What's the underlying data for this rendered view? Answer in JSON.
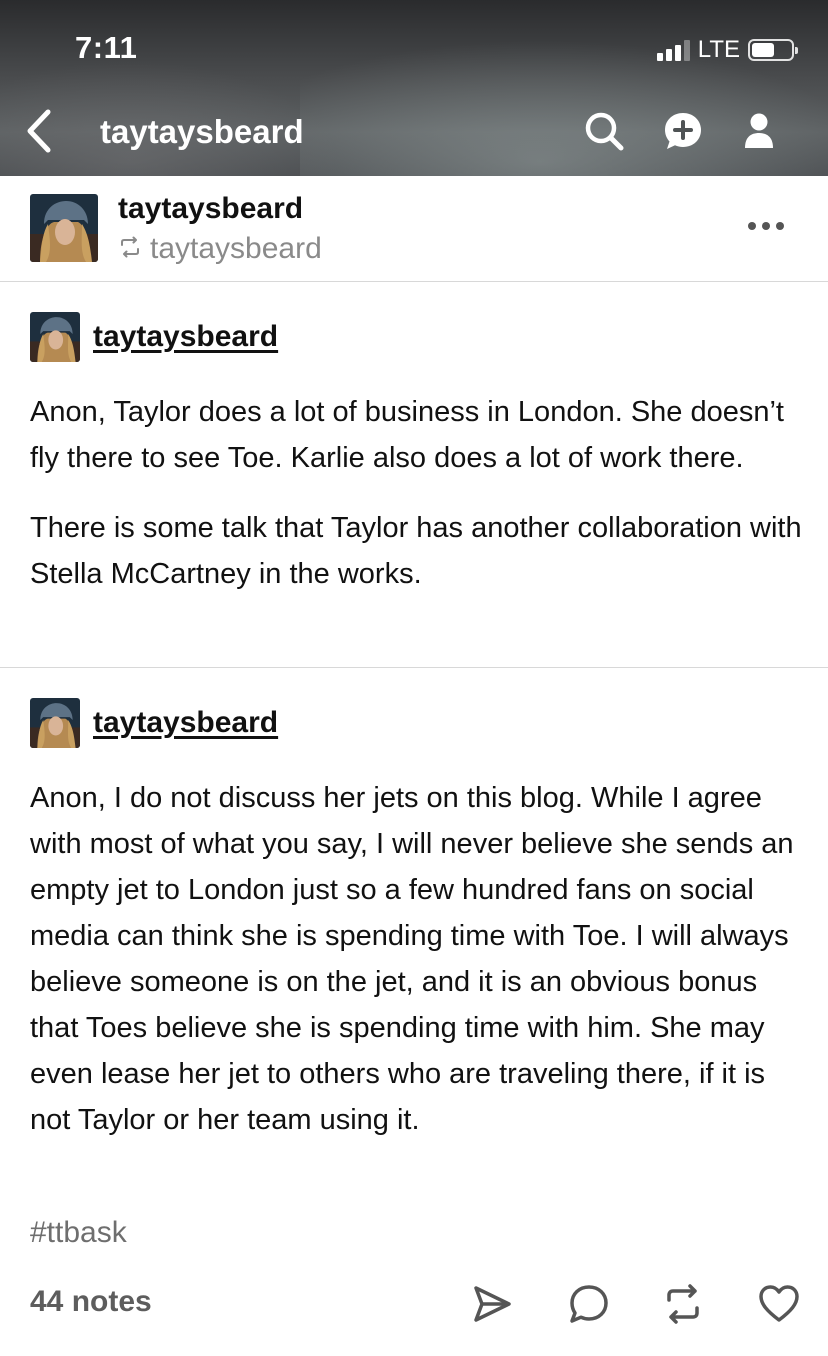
{
  "status_bar": {
    "time": "7:11",
    "network": "LTE"
  },
  "nav": {
    "title": "taytaysbeard",
    "icons": [
      "back-arrow-icon",
      "search-icon",
      "new-message-icon",
      "account-icon"
    ]
  },
  "post": {
    "blog_name": "taytaysbeard",
    "reblogged_from": "taytaysbeard",
    "trail": [
      {
        "name": "taytaysbeard",
        "paragraphs": [
          "Anon, Taylor does a lot of business in London. She doesn’t fly there to see Toe. Karlie also does a lot of work there.",
          "There is some talk that Taylor has another collaboration with Stella McCartney in the works."
        ]
      },
      {
        "name": "taytaysbeard",
        "paragraphs": [
          "Anon, I do not discuss her jets on this blog. While I agree with most of what you say, I will never believe she sends an empty jet to London just so a few hundred fans on social media can think she is spending time with Toe. I will always believe someone is on the jet, and it is an obvious bonus that Toes believe she is spending time with him. She may even lease her jet to others who are traveling there, if it is not Taylor or her team using it."
        ]
      }
    ],
    "tag": "#ttbask",
    "notes": "44 notes"
  },
  "colors": {
    "text": "#111111",
    "muted": "#8a8a8a",
    "divider": "#d8d8d8"
  }
}
